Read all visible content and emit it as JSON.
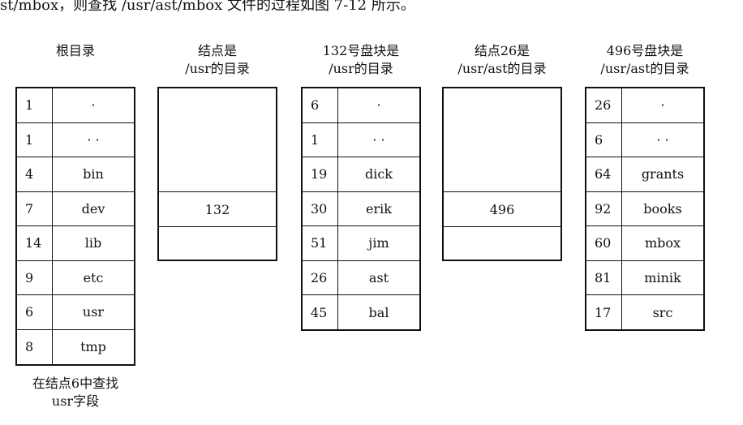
{
  "top_text": "st/mbox，则查找 /usr/ast/mbox 文件的过程如图 7-12 所示。",
  "root": {
    "heading": "根目录",
    "rows": [
      {
        "num": "1",
        "name": "·"
      },
      {
        "num": "1",
        "name": "· ·"
      },
      {
        "num": "4",
        "name": "bin"
      },
      {
        "num": "7",
        "name": "dev"
      },
      {
        "num": "14",
        "name": "lib"
      },
      {
        "num": "9",
        "name": "etc"
      },
      {
        "num": "6",
        "name": "usr"
      },
      {
        "num": "8",
        "name": "tmp"
      }
    ],
    "footer_line1": "在结点6中查找",
    "footer_line2": "usr字段"
  },
  "inode6": {
    "heading_line1": "结点是",
    "heading_line2": "/usr的目录",
    "value": "132"
  },
  "block132": {
    "heading_line1": "132号盘块是",
    "heading_line2": "/usr的目录",
    "rows": [
      {
        "num": "6",
        "name": "·"
      },
      {
        "num": "1",
        "name": "· ·"
      },
      {
        "num": "19",
        "name": "dick"
      },
      {
        "num": "30",
        "name": "erik"
      },
      {
        "num": "51",
        "name": "jim"
      },
      {
        "num": "26",
        "name": "ast"
      },
      {
        "num": "45",
        "name": "bal"
      }
    ]
  },
  "inode26": {
    "heading_line1": "结点26是",
    "heading_line2": "/usr/ast的目录",
    "value": "496"
  },
  "block496": {
    "heading_line1": "496号盘块是",
    "heading_line2": "/usr/ast的目录",
    "rows": [
      {
        "num": "26",
        "name": "·"
      },
      {
        "num": "6",
        "name": "· ·"
      },
      {
        "num": "64",
        "name": "grants"
      },
      {
        "num": "92",
        "name": "books"
      },
      {
        "num": "60",
        "name": "mbox"
      },
      {
        "num": "81",
        "name": "minik"
      },
      {
        "num": "17",
        "name": "src"
      }
    ]
  }
}
